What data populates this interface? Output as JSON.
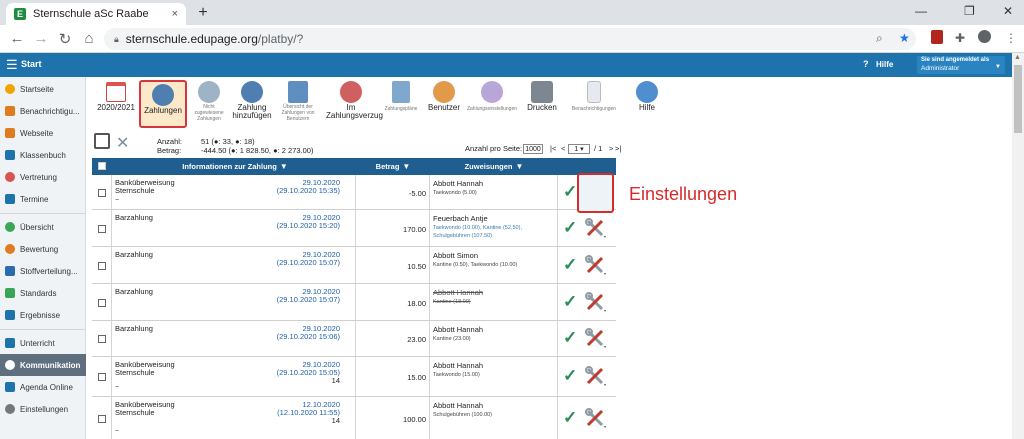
{
  "browser": {
    "tab_title": "Sternschule aSc Raabe",
    "tab_close": "×",
    "new_tab": "+",
    "url_host": "sternschule.edupage.org",
    "url_path": "/platby/?",
    "window_minimize": "—",
    "window_restore": "❐",
    "window_close": "✕"
  },
  "appbar": {
    "menu_label": "Start",
    "help_label": "Hilfe",
    "user_line1": "Sie sind angemeldet als",
    "user_line2": "Administrator"
  },
  "sidebar": {
    "items": [
      {
        "label": "Startseite",
        "icon": "star-icon",
        "color": "#f0a500"
      },
      {
        "label": "Benachrichtigu...",
        "icon": "mail-icon",
        "color": "#e07b1f"
      },
      {
        "label": "Webseite",
        "icon": "web-icon",
        "color": "#e07b1f"
      },
      {
        "label": "Klassenbuch",
        "icon": "book-icon",
        "color": "#1e73ad"
      },
      {
        "label": "Vertretung",
        "icon": "substitution-icon",
        "color": "#d9534f"
      },
      {
        "label": "Termine",
        "icon": "calendar-icon",
        "color": "#1e73ad"
      },
      {
        "label": "Übersicht",
        "icon": "check-circle-icon",
        "color": "#3aa655"
      },
      {
        "label": "Bewertung",
        "icon": "grades-icon",
        "color": "#e07b1f"
      },
      {
        "label": "Stoffverteilung...",
        "icon": "curriculum-icon",
        "color": "#2b6cb0"
      },
      {
        "label": "Standards",
        "icon": "shield-icon",
        "color": "#3aa655"
      },
      {
        "label": "Ergebnisse",
        "icon": "results-icon",
        "color": "#1e73ad"
      },
      {
        "label": "Unterricht",
        "icon": "lesson-icon",
        "color": "#1e73ad"
      },
      {
        "label": "Kommunikation",
        "icon": "chat-icon",
        "color": "#ffffff"
      },
      {
        "label": "Agenda Online",
        "icon": "agenda-icon",
        "color": "#1e73ad"
      },
      {
        "label": "Einstellungen",
        "icon": "gear-icon",
        "color": "#777777"
      }
    ]
  },
  "toolbar": {
    "year": "2020/2021",
    "zahlungen": "Zahlungen",
    "nicht_zugewiesen": "Nicht zugewiesene Zahlungen",
    "zahlung_hinzu_1": "Zahlung",
    "zahlung_hinzu_2": "hinzufügen",
    "uebersicht": "Übersicht der Zahlungen von Benutzern",
    "verzug_1": "Im",
    "verzug_2": "Zahlungsverzug",
    "zahlungsplaene": "Zahlungspläne",
    "benutzer": "Benutzer",
    "zahlungseinstellungen": "Zahlungseinstellungen",
    "drucken": "Drucken",
    "benachrichtigungen": "Benachrichtigungen",
    "hilfe": "Hilfe"
  },
  "summary": {
    "anzahl_label": "Anzahl:",
    "anzahl_value": "51 (●: 33, ●: 18)",
    "betrag_label": "Betrag:",
    "betrag_value": "-444.50 (●: 1 828.50, ●: 2 273.00)",
    "per_page_label": "Anzahl pro Seite:",
    "per_page_value": "1000",
    "pager_first": "|<",
    "pager_prev": "<",
    "page_value": "1",
    "pager_of": "/ 1",
    "pager_next": ">",
    "pager_last": ">|"
  },
  "grid": {
    "col_info": "Informationen zur Zahlung",
    "col_amount": "Betrag",
    "col_assign": "Zuweisungen",
    "rows": [
      {
        "type1": "Banküberweisung",
        "type2": "Sternschule",
        "dash": "−",
        "date1": "29.10.2020",
        "date2": "(29.10.2020 15:35)",
        "extra": "",
        "amount": "-5.00",
        "name": "Abbott Hannah",
        "name_strike": false,
        "sub": "Taekwondo (5.00)",
        "sub_strike": false
      },
      {
        "type1": "Barzahlung",
        "type2": "",
        "dash": "",
        "date1": "29.10.2020",
        "date2": "(29.10.2020 15:20)",
        "extra": "",
        "amount": "170.00",
        "name": "Feuerbach Antje",
        "name_strike": false,
        "sub": "Taekwondo (10.00), Kantine (52.50),",
        "sub2": "Schulgebühren (107.50)",
        "sub_strike": false
      },
      {
        "type1": "Barzahlung",
        "type2": "",
        "dash": "",
        "date1": "29.10.2020",
        "date2": "(29.10.2020 15:07)",
        "extra": "",
        "amount": "10.50",
        "name": "Abbott Simon",
        "name_strike": false,
        "sub": "Kantine (0.50), Taekwondo (10.00)",
        "sub_strike": false
      },
      {
        "type1": "Barzahlung",
        "type2": "",
        "dash": "",
        "date1": "29.10.2020",
        "date2": "(29.10.2020 15:07)",
        "extra": "",
        "amount": "18.00",
        "name": "Abbott Hannah",
        "name_strike": true,
        "sub": "Kantine (18.00)",
        "sub_strike": true
      },
      {
        "type1": "Barzahlung",
        "type2": "",
        "dash": "",
        "date1": "29.10.2020",
        "date2": "(29.10.2020 15:06)",
        "extra": "",
        "amount": "23.00",
        "name": "Abbott Hannah",
        "name_strike": false,
        "sub": "Kantine (23.00)",
        "sub_strike": false
      },
      {
        "type1": "Banküberweisung",
        "type2": "Sternschule",
        "dash": "−",
        "date1": "29.10.2020",
        "date2": "(29.10.2020 15:05)",
        "extra": "14",
        "amount": "15.00",
        "name": "Abbott Hannah",
        "name_strike": false,
        "sub": "Taekwondo (15.00)",
        "sub_strike": false
      },
      {
        "type1": "Banküberweisung",
        "type2": "Sternschule",
        "dash": "−",
        "date1": "12.10.2020",
        "date2": "(12.10.2020 11:55)",
        "extra": "14",
        "amount": "100.00",
        "name": "Abbott Hannah",
        "name_strike": false,
        "sub": "Schulgebühren (100.00)",
        "sub_strike": false
      }
    ]
  },
  "annotation": {
    "label": "Einstellungen",
    "color": "#d62b2b"
  }
}
